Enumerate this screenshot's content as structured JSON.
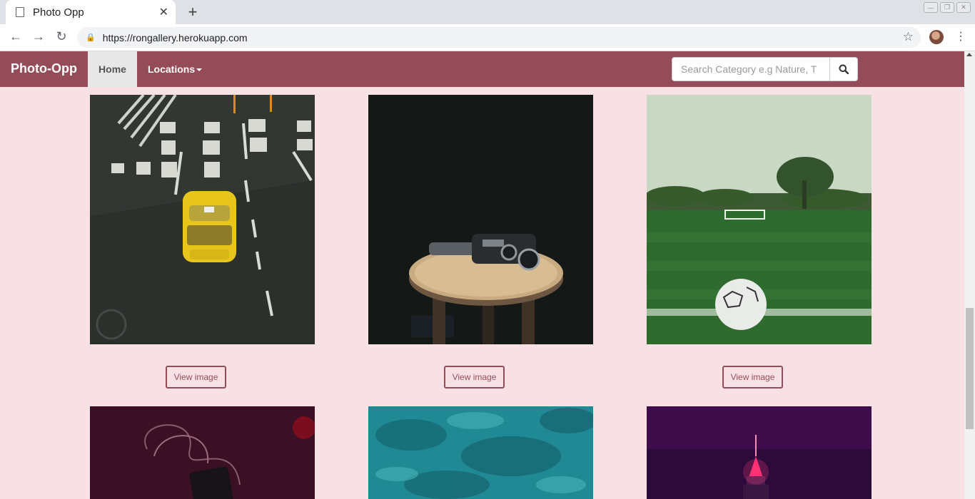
{
  "browser": {
    "tab_title": "Photo Opp",
    "tab_close": "✕",
    "new_tab": "+",
    "url": "https://rongallery.herokuapp.com",
    "window_buttons": [
      "—",
      "❐",
      "✕"
    ],
    "nav": {
      "back": "←",
      "forward": "→",
      "reload": "↻",
      "star": "☆",
      "menu": "⋮",
      "lock": "🔒"
    }
  },
  "site": {
    "brand": "Photo-Opp",
    "nav": {
      "home": "Home",
      "locations": "Locations"
    },
    "search": {
      "placeholder": "Search Category e.g Nature, T"
    },
    "accent_color": "#944d58",
    "background_color": "#f8e1e4"
  },
  "gallery": {
    "button_label": "View image",
    "items": [
      {
        "subject": "yellow-taxi-on-street"
      },
      {
        "subject": "film-camera-on-stool"
      },
      {
        "subject": "soccer-ball-on-field"
      },
      {
        "subject": "phone-with-cables"
      },
      {
        "subject": "turquoise-ocean-aerial"
      },
      {
        "subject": "skyscraper-at-night"
      }
    ]
  }
}
